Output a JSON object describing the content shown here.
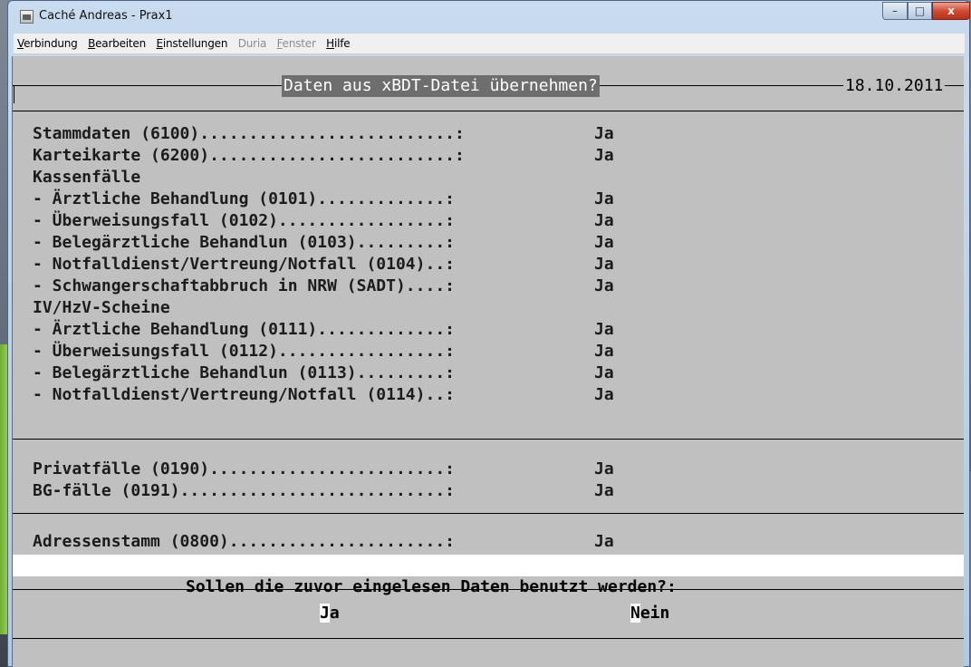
{
  "window": {
    "title": "Caché Andreas - Prax1",
    "controls": {
      "minimize": "–",
      "maximize": "□",
      "close": "x"
    }
  },
  "menu": [
    {
      "first": "V",
      "rest": "erbindung",
      "enabled": true
    },
    {
      "first": "B",
      "rest": "earbeiten",
      "enabled": true
    },
    {
      "first": "E",
      "rest": "instellungen",
      "enabled": true
    },
    {
      "first": "",
      "rest": "Duria",
      "enabled": false
    },
    {
      "first": "F",
      "rest": "enster",
      "enabled": false
    },
    {
      "first": "H",
      "rest": "ilfe",
      "enabled": true
    }
  ],
  "screen": {
    "title": "Daten aus xBDT-Datei übernehmen?",
    "date": "18.10.2011",
    "rows": [
      {
        "label": "Stammdaten (6100)..........................:",
        "value": "Ja"
      },
      {
        "label": "Karteikarte (6200).........................:",
        "value": "Ja"
      },
      {
        "label": "Kassenfälle",
        "value": ""
      },
      {
        "label": "- Ärztliche Behandlung (0101).............:",
        "value": "Ja"
      },
      {
        "label": "- Überweisungsfall (0102).................:",
        "value": "Ja"
      },
      {
        "label": "- Belegärztliche Behandlun (0103).........:",
        "value": "Ja"
      },
      {
        "label": "- Notfalldienst/Vertreung/Notfall (0104)..:",
        "value": "Ja"
      },
      {
        "label": "- Schwangerschaftabbruch in NRW (SADT)....:",
        "value": "Ja"
      },
      {
        "label": "IV/HzV-Scheine",
        "value": ""
      },
      {
        "label": "- Ärztliche Behandlung (0111).............:",
        "value": "Ja"
      },
      {
        "label": "- Überweisungsfall (0112).................:",
        "value": "Ja"
      },
      {
        "label": "- Belegärztliche Behandlun (0113).........:",
        "value": "Ja"
      },
      {
        "label": "- Notfalldienst/Vertreung/Notfall (0114)..:",
        "value": "Ja"
      }
    ],
    "rows2": [
      {
        "label": "Privatfälle (0190)........................:",
        "value": "Ja"
      },
      {
        "label": "BG-fälle (0191)...........................:",
        "value": "Ja"
      }
    ],
    "rows3": [
      {
        "label": "Adressenstamm (0800)......................:",
        "value": "Ja"
      }
    ],
    "question": "Sollen die zuvor eingelesen Daten benutzt werden?:",
    "buttons": {
      "yes": {
        "hot": "J",
        "rest": "a"
      },
      "no": {
        "hot": "N",
        "rest": "ein"
      }
    }
  }
}
